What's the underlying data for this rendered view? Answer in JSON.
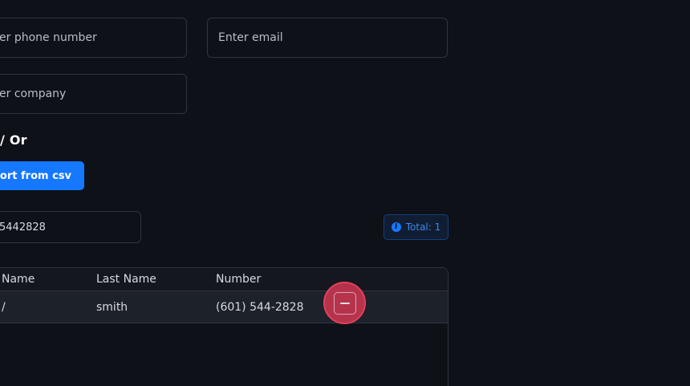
{
  "form": {
    "phone_placeholder": "er phone number",
    "email_placeholder": "Enter email",
    "company_placeholder": "er company"
  },
  "separator_label": "/ Or",
  "import_button_label": "port from csv",
  "search": {
    "value": "5442828"
  },
  "total_badge": {
    "icon": "info-icon",
    "label": "Total: 1"
  },
  "table": {
    "columns": [
      "Name",
      "Last Name",
      "Number"
    ],
    "rows": [
      {
        "first_name": "/",
        "last_name": "smith",
        "number": "(601) 544-2828",
        "action_icon": "minus-icon"
      }
    ]
  },
  "colors": {
    "background": "#0e1117",
    "accent": "#1677ff",
    "danger": "#e4405e"
  }
}
